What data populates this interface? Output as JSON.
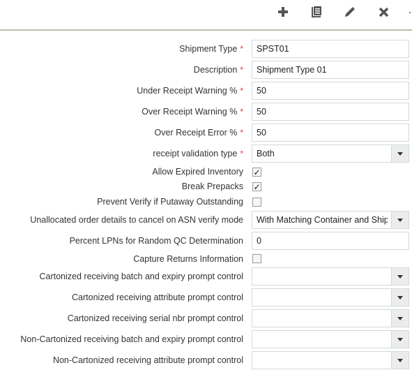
{
  "toolbar": {
    "buttons": [
      {
        "name": "add",
        "icon": "plus-icon"
      },
      {
        "name": "copy",
        "icon": "document-icon"
      },
      {
        "name": "edit",
        "icon": "pencil-icon"
      },
      {
        "name": "delete",
        "icon": "close-icon"
      }
    ]
  },
  "form": {
    "shipment_type": {
      "label": "Shipment Type",
      "required": "*",
      "value": "SPST01"
    },
    "description": {
      "label": "Description",
      "required": "*",
      "value": "Shipment Type 01"
    },
    "under_receipt_warning": {
      "label": "Under Receipt Warning %",
      "required": "*",
      "value": "50"
    },
    "over_receipt_warning": {
      "label": "Over Receipt Warning %",
      "required": "*",
      "value": "50"
    },
    "over_receipt_error": {
      "label": "Over Receipt Error %",
      "required": "*",
      "value": "50"
    },
    "receipt_validation_type": {
      "label": "receipt validation type",
      "required": "*",
      "value": "Both"
    },
    "allow_expired_inventory": {
      "label": "Allow Expired Inventory",
      "checked": true,
      "mark": "✓"
    },
    "break_prepacks": {
      "label": "Break Prepacks",
      "checked": true,
      "mark": "✓"
    },
    "prevent_verify": {
      "label": "Prevent Verify if Putaway Outstanding",
      "checked": false
    },
    "unallocated_order_details": {
      "label": "Unallocated order details to cancel on ASN verify mode",
      "value": "With Matching Container and Shipment"
    },
    "percent_lpns": {
      "label": "Percent LPNs for Random QC Determination",
      "value": "0"
    },
    "capture_returns": {
      "label": "Capture Returns Information",
      "checked": false
    },
    "cart_batch_expiry": {
      "label": "Cartonized receiving batch and expiry prompt control",
      "value": ""
    },
    "cart_attribute": {
      "label": "Cartonized receiving attribute prompt control",
      "value": ""
    },
    "cart_serial": {
      "label": "Cartonized receiving serial nbr prompt control",
      "value": ""
    },
    "noncart_batch_expiry": {
      "label": "Non-Cartonized receiving batch and expiry prompt control",
      "value": ""
    },
    "noncart_attribute": {
      "label": "Non-Cartonized receiving attribute prompt control",
      "value": ""
    }
  }
}
